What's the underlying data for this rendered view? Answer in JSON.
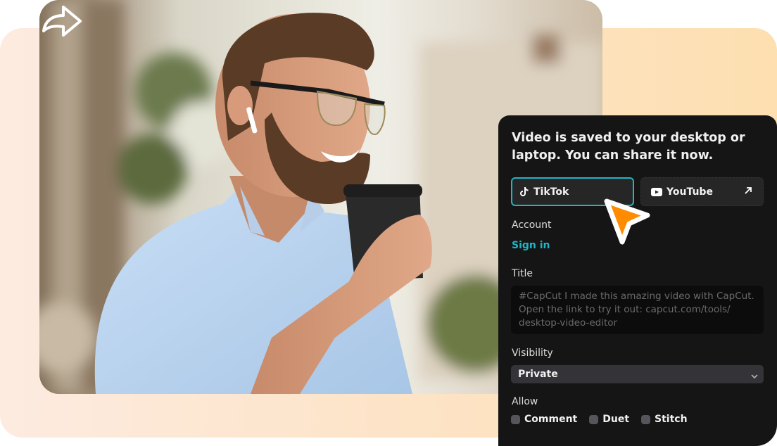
{
  "panel": {
    "title": "Video is saved to your desktop or laptop. You can share it now.",
    "platforms": [
      {
        "label": "TikTok",
        "icon": "tiktok-icon",
        "selected": true
      },
      {
        "label": "YouTube",
        "icon": "youtube-icon",
        "selected": false,
        "external_icon": "external-link-icon"
      }
    ],
    "account_label": "Account",
    "signin_label": "Sign in",
    "title_label": "Title",
    "title_placeholder": "#CapCut I made this amazing video with CapCut. Open the link to try it out: capcut.com/tools/ desktop-video-editor",
    "visibility_label": "Visibility",
    "visibility_value": "Private",
    "allow_label": "Allow",
    "allow_options": [
      {
        "label": "Comment",
        "checked": false
      },
      {
        "label": "Duet",
        "checked": false
      },
      {
        "label": "Stitch",
        "checked": false
      }
    ]
  },
  "photo": {
    "subject": "Smiling bearded man in glasses and light blue shirt holding a coffee cup",
    "overlay_icon": "share-arrow-icon"
  },
  "colors": {
    "accent": "#1fb5c4",
    "panel_bg": "#151515",
    "cursor": "#ff8c00"
  }
}
